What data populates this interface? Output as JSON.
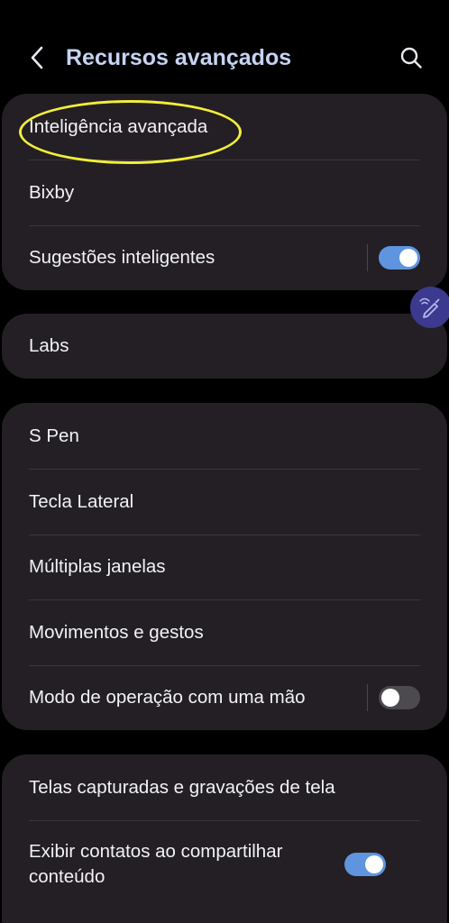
{
  "header": {
    "title": "Recursos avançados",
    "back_icon": "chevron-left-icon",
    "search_icon": "search-icon"
  },
  "groups": [
    {
      "items": [
        {
          "label": "Inteligência avançada",
          "highlighted": true
        },
        {
          "label": "Bixby"
        },
        {
          "label": "Sugestões inteligentes",
          "toggle": true
        }
      ]
    },
    {
      "items": [
        {
          "label": "Labs"
        }
      ]
    },
    {
      "items": [
        {
          "label": "S Pen"
        },
        {
          "label": "Tecla Lateral"
        },
        {
          "label": "Múltiplas janelas"
        },
        {
          "label": "Movimentos e gestos"
        },
        {
          "label": "Modo de operação com uma mão",
          "toggle": false
        }
      ]
    },
    {
      "items": [
        {
          "label": "Telas capturadas e gravações de tela"
        },
        {
          "label": "Exibir contatos ao compartilhar conteúdo",
          "toggle": true
        }
      ]
    }
  ],
  "floating_button": {
    "icon": "pen-icon"
  },
  "colors": {
    "background": "#000000",
    "card": "#231f24",
    "title": "#c6d3f2",
    "toggle_on": "#5e95de",
    "toggle_off": "#4c4a4f",
    "highlight": "#f2ee3a",
    "floating_button": "#3b3a8f"
  }
}
